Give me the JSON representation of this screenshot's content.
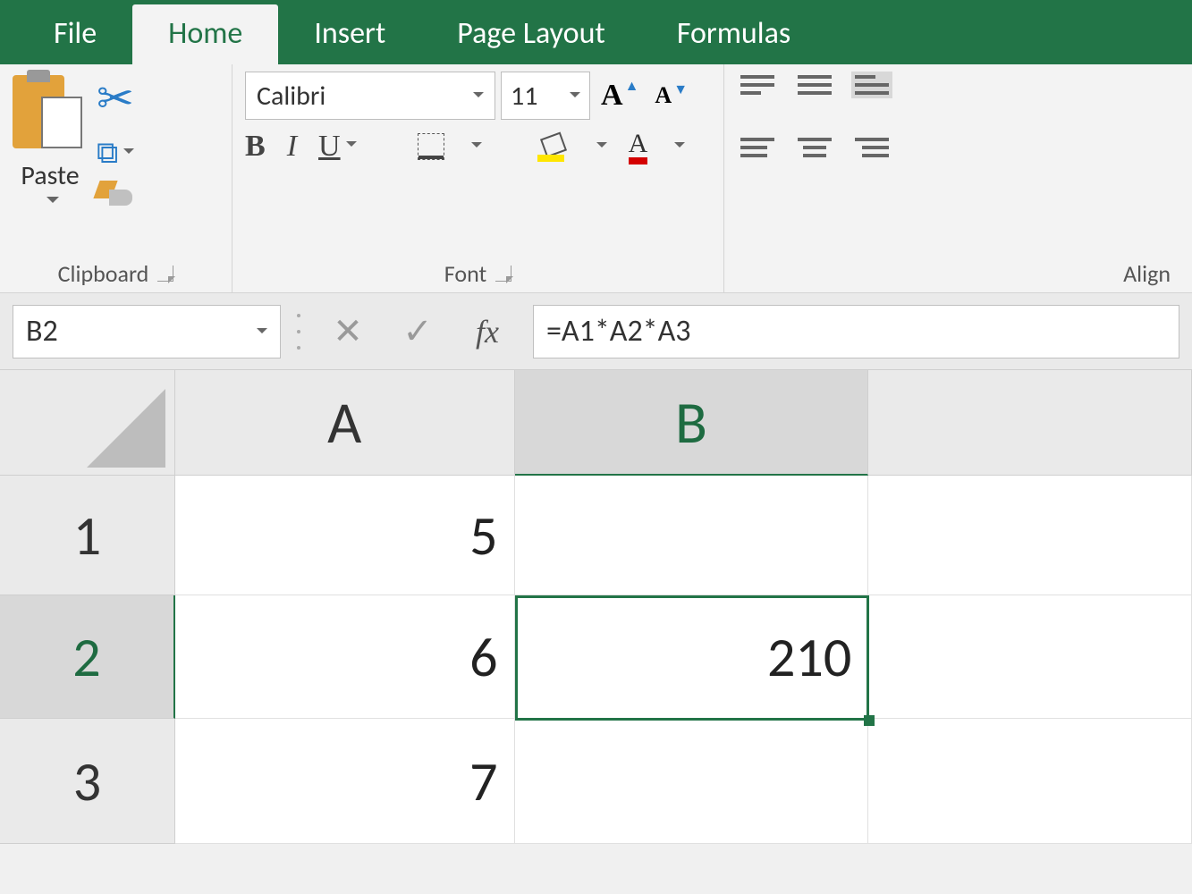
{
  "tabs": {
    "file": "File",
    "home": "Home",
    "insert": "Insert",
    "page_layout": "Page Layout",
    "formulas": "Formulas"
  },
  "ribbon": {
    "clipboard": {
      "label": "Clipboard",
      "paste": "Paste"
    },
    "font": {
      "label": "Font",
      "name": "Calibri",
      "size": "11",
      "bold": "B",
      "italic": "I",
      "underline": "U",
      "fontcolor_glyph": "A",
      "grow_glyph": "A",
      "shrink_glyph": "A"
    },
    "alignment": {
      "label": "Align"
    }
  },
  "formula_bar": {
    "name_box": "B2",
    "cancel": "✕",
    "enter": "✓",
    "fx": "fx",
    "formula": "=A1*A2*A3"
  },
  "columns": {
    "A": "A",
    "B": "B",
    "C": ""
  },
  "rows": {
    "r1": "1",
    "r2": "2",
    "r3": "3"
  },
  "cells": {
    "A1": "5",
    "B1": "",
    "A2": "6",
    "B2": "210",
    "A3": "7",
    "B3": ""
  },
  "selection": {
    "cell": "B2"
  }
}
